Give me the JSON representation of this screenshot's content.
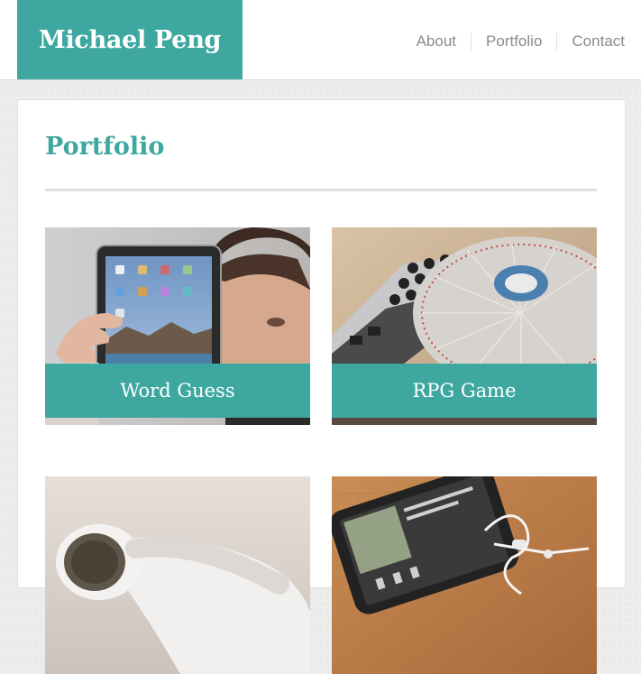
{
  "site": {
    "brand": "Michael Peng",
    "accent_color": "#3ea8a0"
  },
  "nav": {
    "items": [
      {
        "label": "About"
      },
      {
        "label": "Portfolio"
      },
      {
        "label": "Contact"
      }
    ]
  },
  "main": {
    "title": "Portfolio",
    "projects": [
      {
        "label": "Word Guess",
        "image": "person-holding-tablet"
      },
      {
        "label": "RPG Game",
        "image": "dj-turntable"
      },
      {
        "label": "",
        "image": "earbuds"
      },
      {
        "label": "",
        "image": "smartphone-with-earphones"
      }
    ]
  }
}
